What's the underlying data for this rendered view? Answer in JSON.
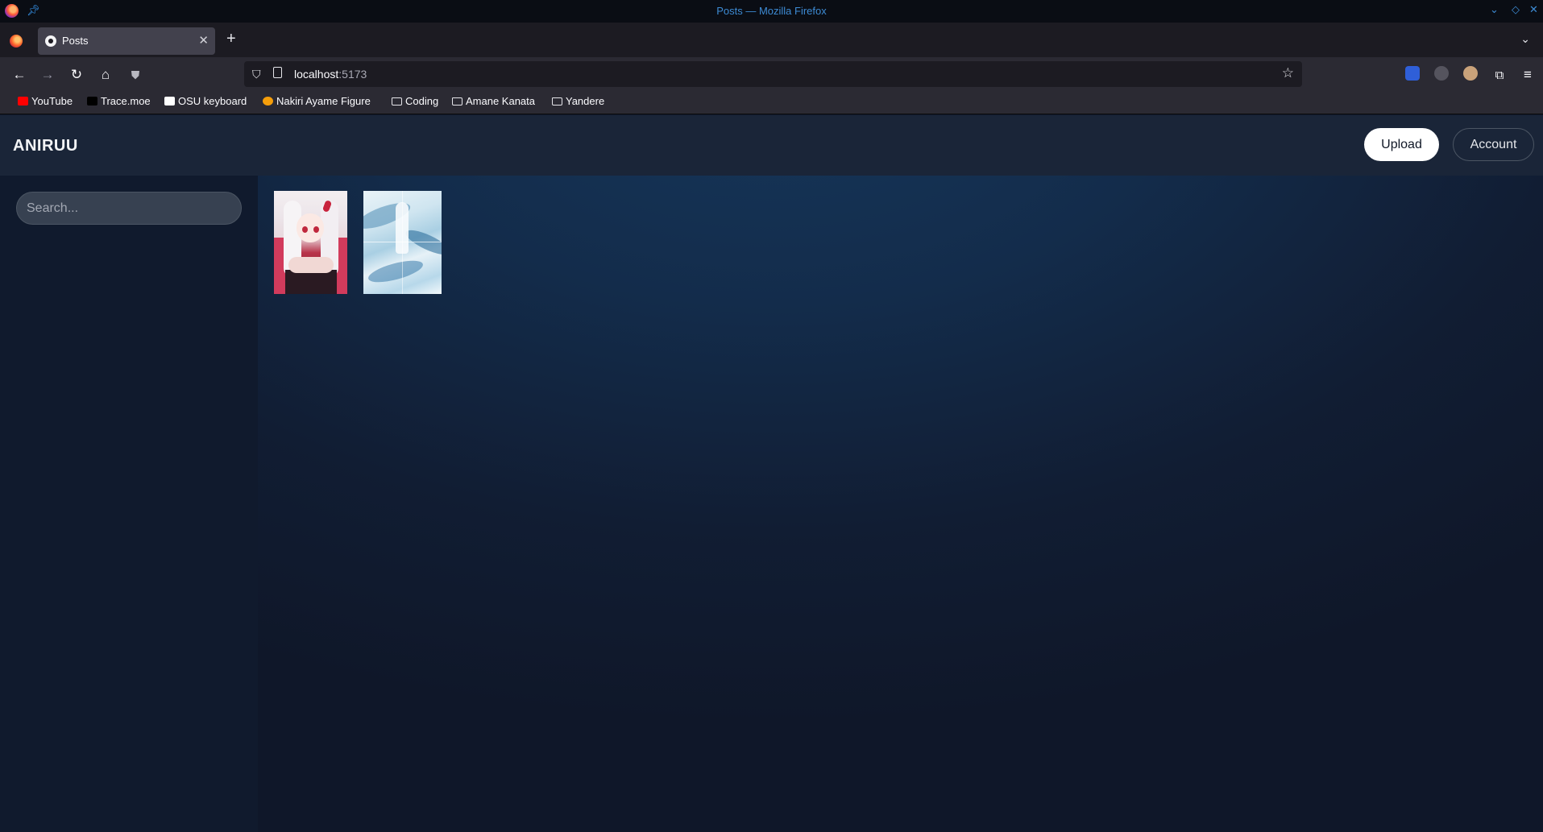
{
  "window": {
    "title": "Posts — Mozilla Firefox"
  },
  "tabs": [
    {
      "label": "Posts",
      "active": true
    }
  ],
  "address_bar": {
    "host": "localhost",
    "port": ":5173"
  },
  "bookmarks": [
    {
      "label": "YouTube",
      "icon": "youtube-icon",
      "color": "#ff0000"
    },
    {
      "label": "Trace.moe",
      "icon": "trace-moe-icon",
      "color": "#000000"
    },
    {
      "label": "OSU keyboard",
      "icon": "amazon-icon",
      "color": "#ffffff"
    },
    {
      "label": "Nakiri Ayame Figure",
      "icon": "search-orange-icon",
      "color": "#f59e0b"
    },
    {
      "label": "Coding",
      "icon": "folder-icon"
    },
    {
      "label": "Amane Kanata",
      "icon": "folder-icon"
    },
    {
      "label": "Yandere",
      "icon": "folder-icon"
    }
  ],
  "app": {
    "brand": "ANIRUU",
    "upload_label": "Upload",
    "account_label": "Account",
    "search_placeholder": "Search..."
  },
  "posts": [
    {
      "name": "post-thumbnail-1",
      "description": "white-haired anime girl in red kimono"
    },
    {
      "name": "post-thumbnail-2",
      "description": "blue and white watercolor waves"
    }
  ],
  "colors": {
    "header_bg": "#1a2538",
    "sidebar_bg": "#101a2d",
    "page_bg": "#132c4b",
    "title_accent": "#3d8bd4"
  }
}
